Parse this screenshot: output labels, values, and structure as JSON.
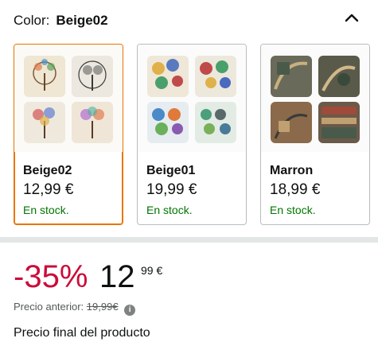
{
  "color_selector": {
    "label": "Color:",
    "selected": "Beige02"
  },
  "variants": [
    {
      "name": "Beige02",
      "price": "12,99 €",
      "stock": "En stock.",
      "selected": true
    },
    {
      "name": "Beige01",
      "price": "19,99 €",
      "stock": "En stock.",
      "selected": false
    },
    {
      "name": "Marron",
      "price": "18,99 €",
      "stock": "En stock.",
      "selected": false
    }
  ],
  "pricing": {
    "discount": "-35%",
    "whole": "12",
    "fraction": "99 €",
    "previous_label": "Precio anterior:",
    "previous_value": "19,99€",
    "info_icon": "i",
    "final_label": "Precio final del producto"
  },
  "colors": {
    "accent_border": "#e77600",
    "discount": "#cc0c39",
    "in_stock": "#007600"
  }
}
